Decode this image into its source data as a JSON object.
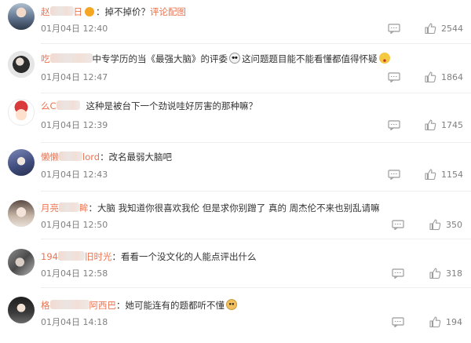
{
  "comments": [
    {
      "user_prefix": "赵",
      "user_suffix": "日",
      "text_before": "：掉不掉价？",
      "link": "评论配图",
      "time": "01月04日 12:40",
      "likes": "2544"
    },
    {
      "user_prefix": "吃",
      "user_suffix": "",
      "text_before": "中专学历的当《最强大脑》的评委",
      "text_after": "这问题题目能不能看懂都值得怀疑",
      "time": "01月04日 12:47",
      "likes": "1864"
    },
    {
      "user_prefix": "么C",
      "user_suffix": "",
      "text_before": "这种是被台下一个劲说哇好厉害的那种嘛？",
      "time": "01月04日 12:39",
      "likes": "1745"
    },
    {
      "user_prefix": "懒懒",
      "user_suffix": "lord",
      "text_before": "：改名最弱大脑吧",
      "time": "01月04日 12:43",
      "likes": "1154"
    },
    {
      "user_prefix": "月亮",
      "user_suffix": "眸",
      "text_before": "：大脑 我知道你很喜欢我伦 但是求你别蹭了 真的 周杰伦不来也别乱请嘛",
      "time": "01月04日 12:50",
      "likes": "350"
    },
    {
      "user_prefix": "194",
      "user_suffix": "旧时光",
      "text_before": "：看看一个没文化的人能点评出什么",
      "time": "01月04日 12:58",
      "likes": "318"
    },
    {
      "user_prefix": "格",
      "user_suffix": "阿西巴",
      "text_before": "：她可能连有的题都听不懂",
      "time": "01月04日 14:18",
      "likes": "194"
    }
  ],
  "icons": {
    "reply": "comment-reply-icon",
    "like": "thumbs-up-icon"
  },
  "colors": {
    "username": "#eb7350",
    "text": "#333333",
    "meta": "#808080"
  }
}
